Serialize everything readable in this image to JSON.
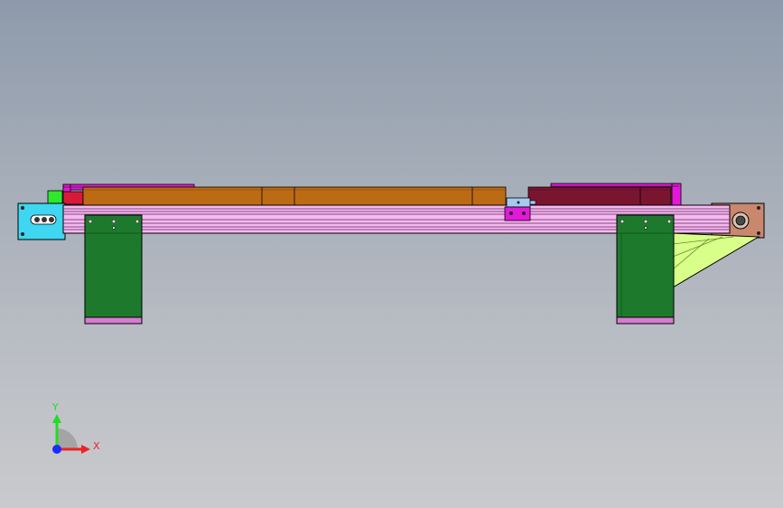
{
  "view": {
    "background_top": "#8e9aab",
    "background_bottom": "#c9cacd"
  },
  "triad": {
    "y_label": "Y",
    "x_label": "X",
    "y_color": "#22dd22",
    "x_color": "#ee2222",
    "z_color": "#1a2cff"
  },
  "colors": {
    "rail": "#f6b8f0",
    "rail_stripe": "#5a2a5a",
    "green_block": "#1d7a2c",
    "brown_carriage": "#bd6a14",
    "maroon_carriage": "#7a1530",
    "magenta": "#e21ad8",
    "cyan_endplate": "#3ed6f0",
    "tan_endplate": "#c9876e",
    "yellow_bracket": "#d8ff8a",
    "light_green": "#2ee82e",
    "pink_foot": "#d77bd1"
  }
}
